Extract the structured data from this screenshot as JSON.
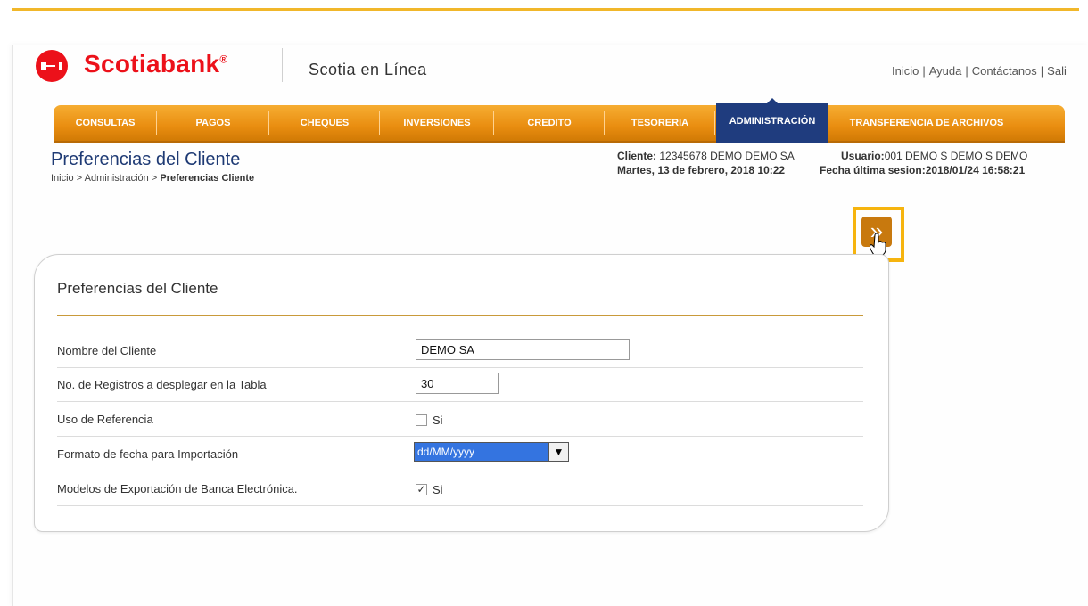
{
  "header": {
    "brand": "Scotiabank",
    "brand_reg": "®",
    "product": "Scotia en Línea",
    "links": [
      "Inicio",
      "Ayuda",
      "Contáctanos",
      "Sali"
    ]
  },
  "nav": {
    "items": [
      "CONSULTAS",
      "PAGOS",
      "CHEQUES",
      "INVERSIONES",
      "CREDITO",
      "TESORERIA",
      "ADMINISTRACIÓN",
      "TRANSFERENCIA DE ARCHIVOS"
    ],
    "active": "ADMINISTRACIÓN"
  },
  "page": {
    "title": "Preferencias del Cliente",
    "breadcrumb": {
      "home": "Inicio",
      "section": "Administración",
      "current": "Preferencias Cliente",
      "separator": ">"
    }
  },
  "session": {
    "cliente_label": "Cliente:",
    "cliente_value": "12345678 DEMO DEMO SA",
    "date": "Martes, 13 de febrero, 2018 10:22",
    "usuario_label": "Usuario:",
    "usuario_value": "001 DEMO S DEMO S DEMO",
    "last_session_label": "Fecha última sesion:",
    "last_session_value": "2018/01/24 16:58:21"
  },
  "next_button": {
    "symbol": "»",
    "icon": "double-chevron-right-icon"
  },
  "form": {
    "title": "Preferencias del Cliente",
    "nombre_label": "Nombre del Cliente",
    "nombre_value": "DEMO SA",
    "registros_label": "No. de Registros a desplegar en la Tabla",
    "registros_value": "30",
    "referencia_label": "Uso de Referencia",
    "referencia_option": "Si",
    "referencia_checked": false,
    "formato_label": "Formato de fecha para Importación",
    "formato_value": "dd/MM/yyyy",
    "modelos_label": "Modelos de Exportación de Banca Electrónica.",
    "modelos_option": "Si",
    "modelos_checked": true
  },
  "colors": {
    "accent": "#f1b72a",
    "nav": "#e98d10",
    "active": "#1f3c7e",
    "brand": "#ec111a"
  }
}
